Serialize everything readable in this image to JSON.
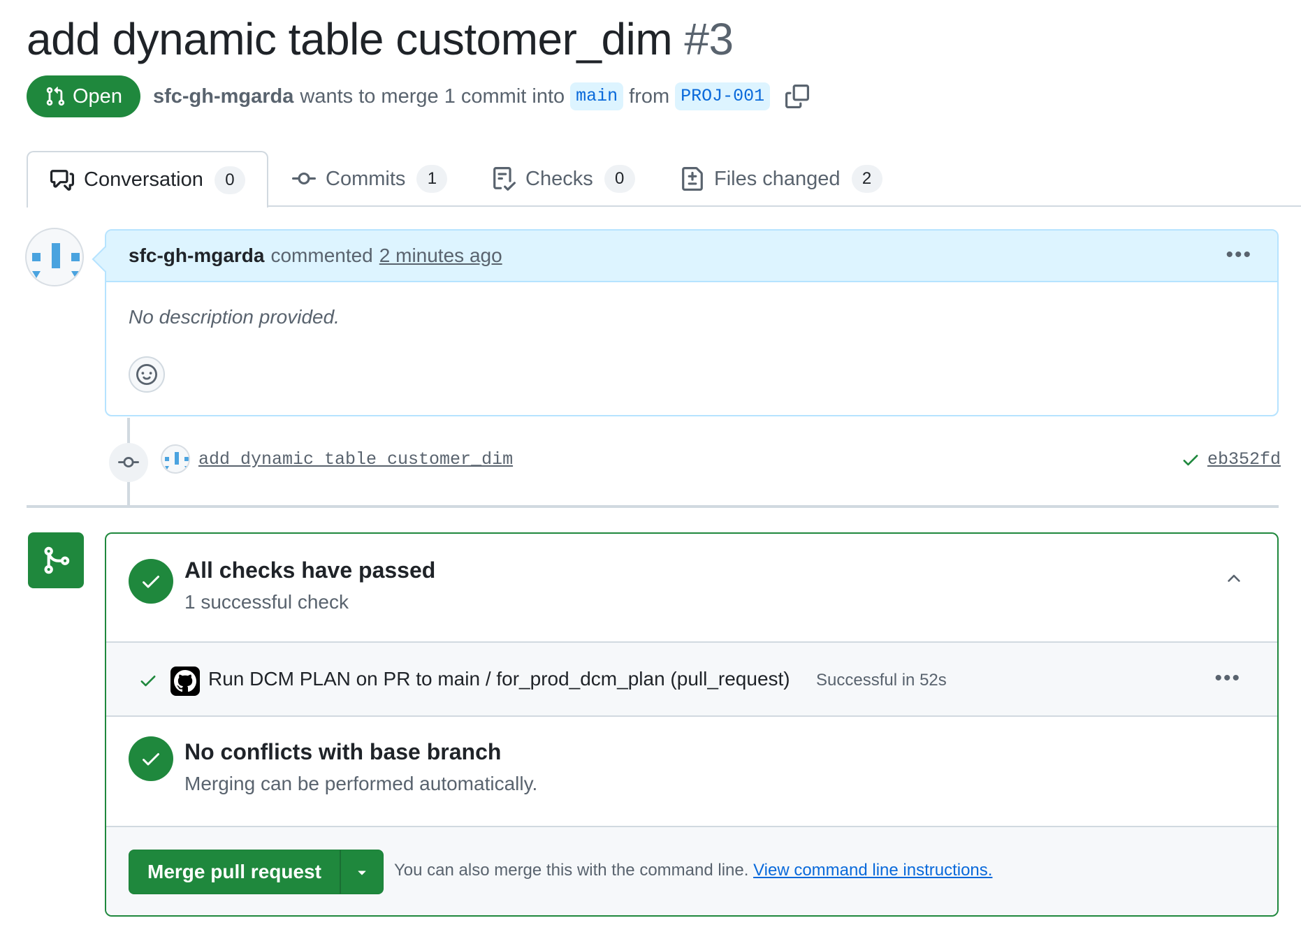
{
  "pr": {
    "title": "add dynamic table customer_dim",
    "number": "#3",
    "state": "Open",
    "author": "sfc-gh-mgarda",
    "merge_text": "wants to merge 1 commit into",
    "base_branch": "main",
    "from_text": "from",
    "head_branch": "PROJ-001"
  },
  "tabs": [
    {
      "label": "Conversation",
      "count": "0",
      "icon": "comment-discussion-icon"
    },
    {
      "label": "Commits",
      "count": "1",
      "icon": "git-commit-icon"
    },
    {
      "label": "Checks",
      "count": "0",
      "icon": "checklist-icon"
    },
    {
      "label": "Files changed",
      "count": "2",
      "icon": "file-diff-icon"
    }
  ],
  "comment": {
    "author": "sfc-gh-mgarda",
    "action": "commented",
    "time": "2 minutes ago",
    "body": "No description provided."
  },
  "commit": {
    "message": "add dynamic table customer_dim",
    "sha": "eb352fd"
  },
  "merge_box": {
    "checks_title": "All checks have passed",
    "checks_sub": "1 successful check",
    "run_name": "Run DCM PLAN on PR to main / for_prod_dcm_plan (pull_request)",
    "run_status": "Successful in 52s",
    "conflict_title": "No conflicts with base branch",
    "conflict_sub": "Merging can be performed automatically.",
    "merge_button": "Merge pull request",
    "note": "You can also merge this with the command line.",
    "note_link": "View command line instructions."
  },
  "colors": {
    "success": "#1f883d",
    "link": "#0969da",
    "comment_header": "#ddf4ff"
  }
}
